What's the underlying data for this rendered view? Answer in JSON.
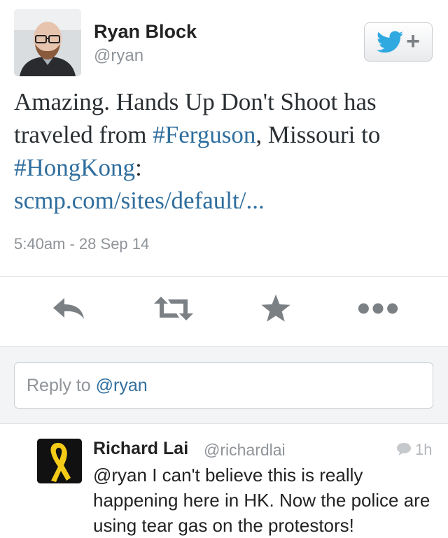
{
  "tweet": {
    "author_name": "Ryan Block",
    "author_handle": "@ryan",
    "text": {
      "t1": "Amazing. Hands Up Don't Shoot has traveled from ",
      "hashtag1": "#Ferguson",
      "t2": ", Missouri to ",
      "hashtag2": "#HongKong",
      "t3": ":",
      "link": "scmp.com/sites/default/..."
    },
    "timestamp": "5:40am - 28 Sep 14"
  },
  "follow_button": {
    "icon": "twitter-bird-icon",
    "symbol": "+"
  },
  "actions": [
    {
      "name": "reply",
      "icon": "reply-arrow-icon"
    },
    {
      "name": "retweet",
      "icon": "retweet-icon"
    },
    {
      "name": "favorite",
      "icon": "star-icon"
    },
    {
      "name": "more",
      "icon": "more-dots-icon"
    }
  ],
  "reply_box": {
    "placeholder_prefix": "Reply to ",
    "mention": "@ryan"
  },
  "reply": {
    "author_name": "Richard Lai",
    "author_handle": "@richardlai",
    "time": "1h",
    "text": "@ryan I can't believe this is really happening here in HK. Now the police are using tear gas on the protestors!",
    "avatar_icon": "yellow-ribbon-icon"
  },
  "colors": {
    "link": "#2f6e9e",
    "twitter_blue": "#2fa9e0",
    "icon_gray": "#7b8085",
    "ribbon": "#f4cc17"
  }
}
